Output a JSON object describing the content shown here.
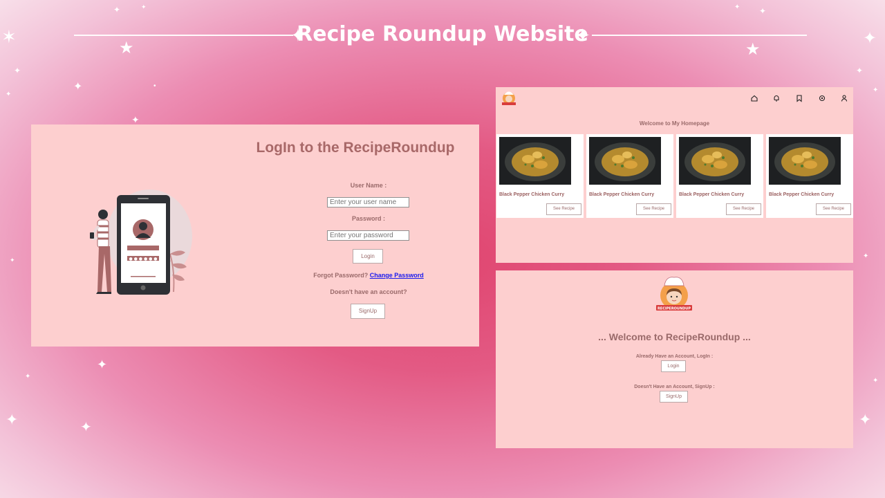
{
  "header": {
    "title": "Recipe Roundup Website"
  },
  "login": {
    "title": "LogIn to the RecipeRoundup",
    "username_label": "User Name :",
    "username_placeholder": "Enter your user name",
    "password_label": "Password :",
    "password_placeholder": "Enter your password",
    "login_button": "Login",
    "forgot_text": "Forgot Password?",
    "change_password_link": "Change Password",
    "no_account_text": "Doesn't have an account?",
    "signup_button": "SignUp",
    "password_mask": "••••••"
  },
  "home": {
    "title": "Welcome to My Homepage",
    "nav_icons": [
      "home-icon",
      "bell-icon",
      "bookmark-icon",
      "settings-icon",
      "user-icon"
    ],
    "cards": [
      {
        "title": "Black Pepper Chicken Curry",
        "button": "See Recipe"
      },
      {
        "title": "Black Pepper Chicken Curry",
        "button": "See Recipe"
      },
      {
        "title": "Black Pepper Chicken Curry",
        "button": "See Recipe"
      },
      {
        "title": "Black Pepper Chicken Curry",
        "button": "See Recipe"
      }
    ]
  },
  "welcome": {
    "logo_text": "RECIPEROUNDUP",
    "title": "... Welcome to RecipeRoundup ...",
    "login_prompt": "Already Have an Account, LogIn :",
    "login_button": "Login",
    "signup_prompt": "Doesn't Have an Account, SignUp :",
    "signup_button": "SignUp"
  },
  "colors": {
    "panel_bg": "#fdcfcf",
    "accent_text": "#a86868",
    "link": "#1a1aee"
  }
}
